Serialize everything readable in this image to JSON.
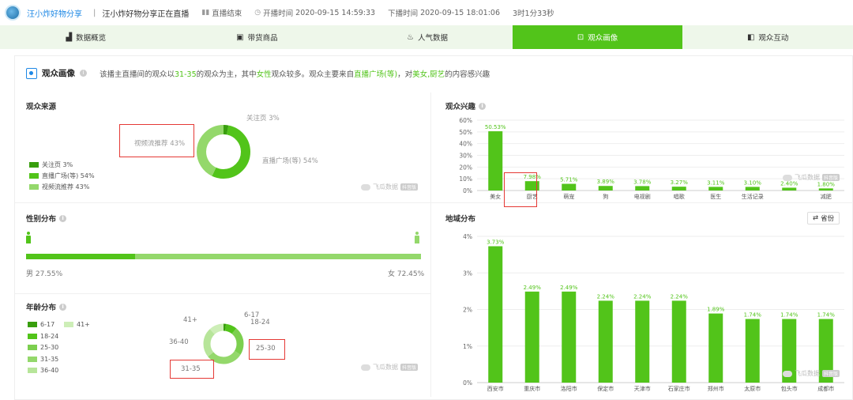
{
  "header": {
    "streamer_name": "汪小炸好物分享",
    "separator": "|",
    "live_title": "汪小炸好物分享正在直播",
    "status": "直播结束",
    "start_label": "开播时间",
    "start_time": "2020-09-15 14:59:33",
    "end_label": "下播时间",
    "end_time": "2020-09-15 18:01:06",
    "duration": "3时1分33秒"
  },
  "tabs": [
    {
      "label": "数据概览",
      "icon": "bar-chart-icon",
      "active": false
    },
    {
      "label": "带货商品",
      "icon": "shopping-bag-icon",
      "active": false
    },
    {
      "label": "人气数据",
      "icon": "flame-icon",
      "active": false
    },
    {
      "label": "观众画像",
      "icon": "audience-portrait-icon",
      "active": true
    },
    {
      "label": "观众互动",
      "icon": "interaction-icon",
      "active": false
    }
  ],
  "panel": {
    "title": "观众画像",
    "summary_parts": [
      "该播主直播间的观众以",
      "31-35",
      "的观众为主，其中",
      "女性",
      "观众较多。观众主要来自",
      "直播广场(等)",
      "，对",
      "美女,厨艺",
      "的内容感兴趣"
    ]
  },
  "colors": {
    "primary": "#52c41a",
    "light": "#94d86b",
    "lighter": "#b7e59a",
    "dark": "#389e0d",
    "highlight_box": "#e53935",
    "link": "#1e88e5"
  },
  "source": {
    "title": "观众来源",
    "slices": [
      {
        "name": "关注页",
        "pct": 3,
        "label": "关注页 3%",
        "color": "#389e0d"
      },
      {
        "name": "直播广场(等)",
        "pct": 54,
        "label": "直播广场(等) 54%",
        "color": "#52c41a"
      },
      {
        "name": "视频流推荐",
        "pct": 43,
        "label": "视频流推荐 43%",
        "color": "#94d86b"
      }
    ],
    "legend": [
      "关注页 3%",
      "直播广场(等) 54%",
      "视频流推荐 43%"
    ]
  },
  "gender": {
    "title": "性别分布",
    "male_pct": 27.55,
    "male_label": "男 27.55%",
    "female_label": "女 72.45%"
  },
  "age": {
    "title": "年龄分布",
    "legend": [
      "6-17",
      "41+",
      "18-24",
      "25-30",
      "31-35",
      "36-40"
    ],
    "slices": [
      {
        "name": "6-17",
        "pct": 2,
        "color": "#389e0d"
      },
      {
        "name": "18-24",
        "pct": 9,
        "color": "#52c41a"
      },
      {
        "name": "25-30",
        "pct": 23,
        "color": "#7ccf4f"
      },
      {
        "name": "31-35",
        "pct": 30,
        "color": "#94d86b"
      },
      {
        "name": "36-40",
        "pct": 24,
        "color": "#b7e59a"
      },
      {
        "name": "41+",
        "pct": 12,
        "color": "#cdeeb7"
      }
    ]
  },
  "watermark": {
    "text": "飞瓜数据",
    "tag": "抖音版"
  },
  "chart_data": [
    {
      "type": "bar",
      "title": "观众兴趣",
      "categories": [
        "美女",
        "厨艺",
        "萌宠",
        "狗",
        "电视剧",
        "唱歌",
        "医生",
        "生活记录",
        "",
        "减肥"
      ],
      "values": [
        50.53,
        7.98,
        5.71,
        3.89,
        3.78,
        3.27,
        3.11,
        3.1,
        2.4,
        1.8
      ],
      "value_labels": [
        "50.53%",
        "7.98%",
        "5.71%",
        "3.89%",
        "3.78%",
        "3.27%",
        "3.11%",
        "3.10%",
        "2.40%",
        "1.80%"
      ],
      "yticks": [
        "0%",
        "10%",
        "20%",
        "30%",
        "40%",
        "50%",
        "60%"
      ],
      "ylim": [
        0,
        60
      ],
      "grid": true,
      "color": "#52c41a"
    },
    {
      "type": "bar",
      "title": "地域分布",
      "toggle_label": "省份",
      "categories": [
        "西安市",
        "重庆市",
        "洛阳市",
        "保定市",
        "天津市",
        "石家庄市",
        "郑州市",
        "太原市",
        "包头市",
        "成都市"
      ],
      "values": [
        3.73,
        2.49,
        2.49,
        2.24,
        2.24,
        2.24,
        1.89,
        1.74,
        1.74,
        1.74
      ],
      "value_labels": [
        "3.73%",
        "2.49%",
        "2.49%",
        "2.24%",
        "2.24%",
        "2.24%",
        "1.89%",
        "1.74%",
        "1.74%",
        "1.74%"
      ],
      "yticks": [
        "0%",
        "1%",
        "2%",
        "3%",
        "4%"
      ],
      "ylim": [
        0,
        4
      ],
      "grid": true,
      "color": "#52c41a"
    }
  ]
}
